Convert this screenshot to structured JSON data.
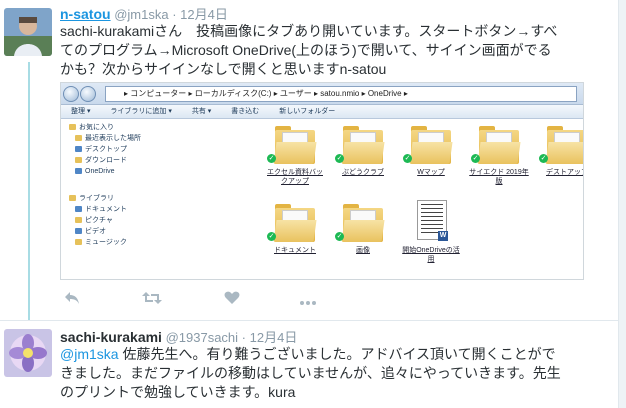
{
  "tweet1": {
    "display_name": "n-satou",
    "handle": "@jm1ska",
    "separator": "·",
    "time": "12月4日",
    "text_lines": [
      "sachi-kurakamiさん　投稿画像にタブあり開いています。スタートボタン→すべ",
      "てのプログラム→Microsoft OneDrive(上のほう)で開いて、サイイン画面がでる",
      "かも？次からサイインなしで開くと思いますn-satou"
    ],
    "media": {
      "address_path": "▸ コンピューター ▸ ローカルディスク(C:) ▸ ユーザー ▸ satou.nmio ▸ OneDrive ▸",
      "toolbar": [
        "整理 ▾",
        "ライブラリに追加 ▾",
        "共有 ▾",
        "書き込む",
        "新しいフォルダー"
      ],
      "sidebar_top": [
        "お気に入り",
        "最近表示した場所",
        "デスクトップ",
        "ダウンロード",
        "OneDrive"
      ],
      "sidebar_libraries": [
        "ライブラリ",
        "ドキュメント",
        "ピクチャ",
        "ビデオ",
        "ミュージック"
      ],
      "files": [
        {
          "label": "エクセル資料バックアップ",
          "type": "folder"
        },
        {
          "label": "ぶどうクラブ",
          "type": "folder"
        },
        {
          "label": "Wマップ",
          "type": "folder"
        },
        {
          "label": "サイエクド 2019年版",
          "type": "folder"
        },
        {
          "label": "デストアップ",
          "type": "folder"
        },
        {
          "label": "ドキュメント",
          "type": "folder"
        },
        {
          "label": "画像",
          "type": "folder"
        },
        {
          "label": "開始OneDriveの活用",
          "type": "document"
        }
      ]
    },
    "actions": {
      "reply_icon": "reply-icon",
      "retweet_icon": "retweet-icon",
      "like_icon": "heart-icon",
      "more_icon": "more-icon"
    }
  },
  "tweet2": {
    "display_name": "sachi-kurakami",
    "handle": "@1937sachi",
    "separator": "·",
    "time": "12月4日",
    "mention": "@jm1ska",
    "text_line1_rest": " 佐藤先生へ。有り難うございました。アドバイス頂いて開くことがで",
    "text_line2": "きました。まだファイルの移動はしていませんが、追々にやっていきます。先生",
    "text_line3": "のプリントで勉強していきます。kura"
  },
  "colors": {
    "accent": "#1b95e0",
    "thread_line": "#a8dce4",
    "muted": "#8899a6",
    "text": "#292f33"
  }
}
